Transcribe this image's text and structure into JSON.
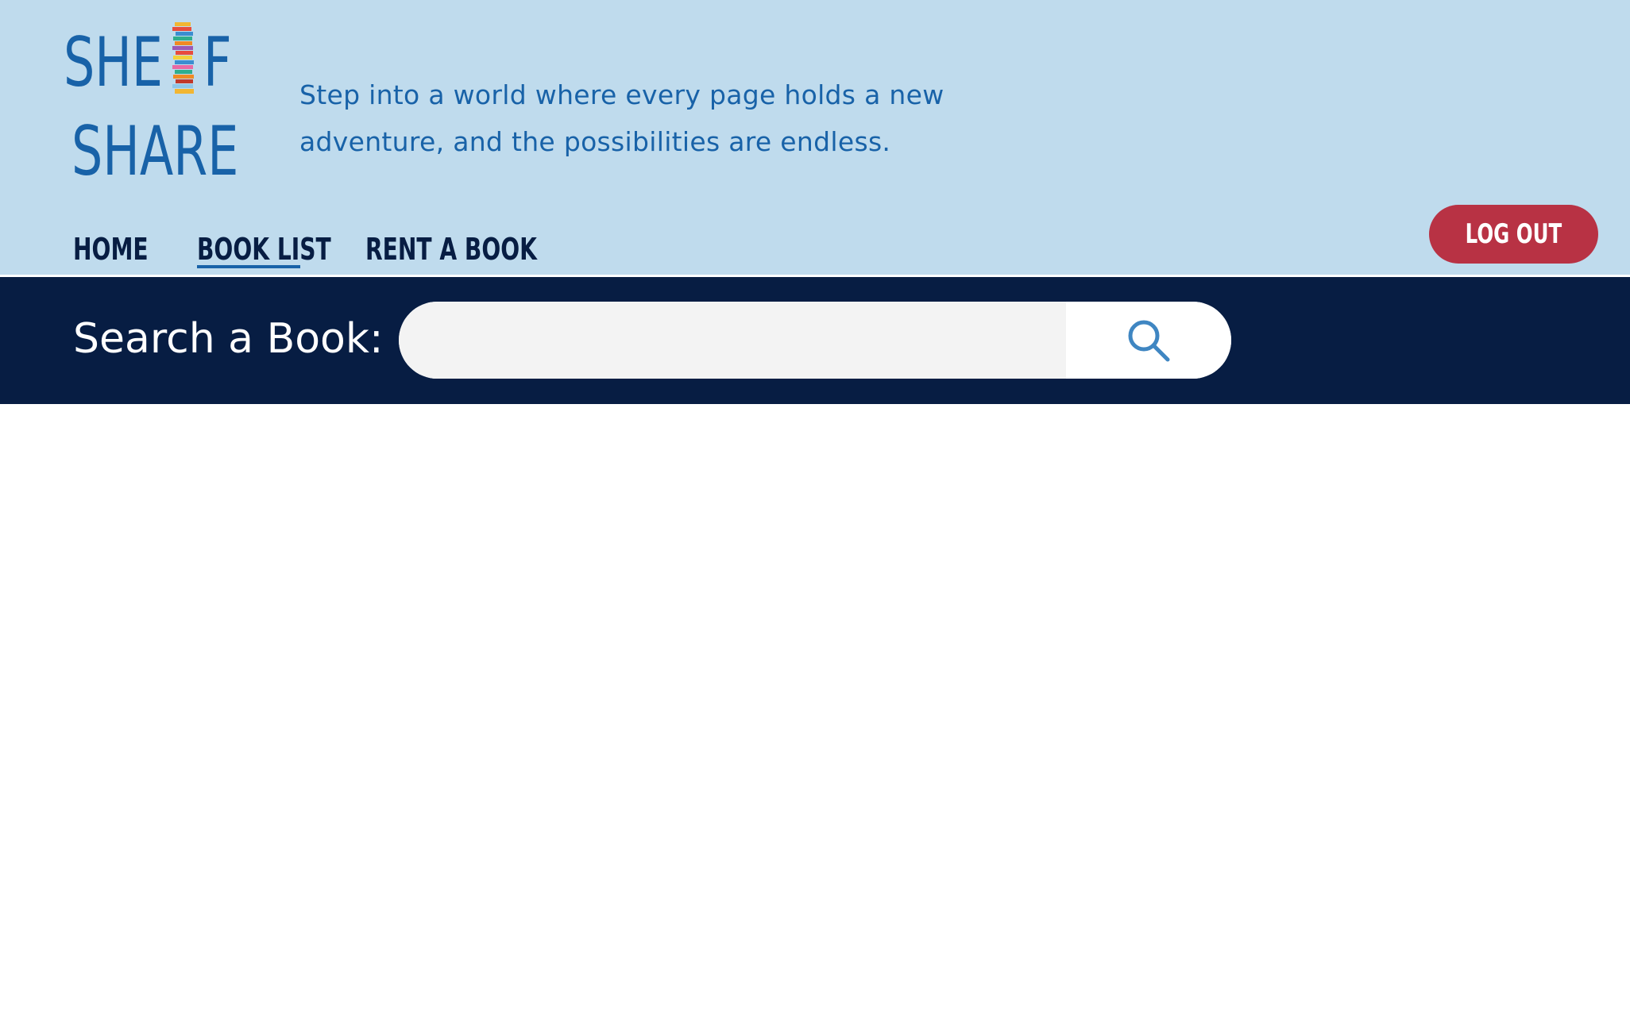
{
  "brand": {
    "logo_line1": "SHE",
    "logo_line1_end": "F",
    "logo_line2": "SHARE",
    "accent": "#1862a8"
  },
  "header": {
    "tagline_line1": "Step into a world where every page holds a new",
    "tagline_line2": "adventure, and the possibilities are endless.",
    "background": "#bfdbed"
  },
  "nav": {
    "items": [
      {
        "label": "HOME",
        "active": false
      },
      {
        "label": "BOOK LIST",
        "active": true
      },
      {
        "label": "RENT A BOOK",
        "active": false
      }
    ],
    "logout_label": "LOG OUT",
    "logout_color": "#b83244"
  },
  "search": {
    "label": "Search a Book:",
    "value": "",
    "placeholder": "",
    "button_icon": "search-icon",
    "band_color": "#071d43"
  }
}
